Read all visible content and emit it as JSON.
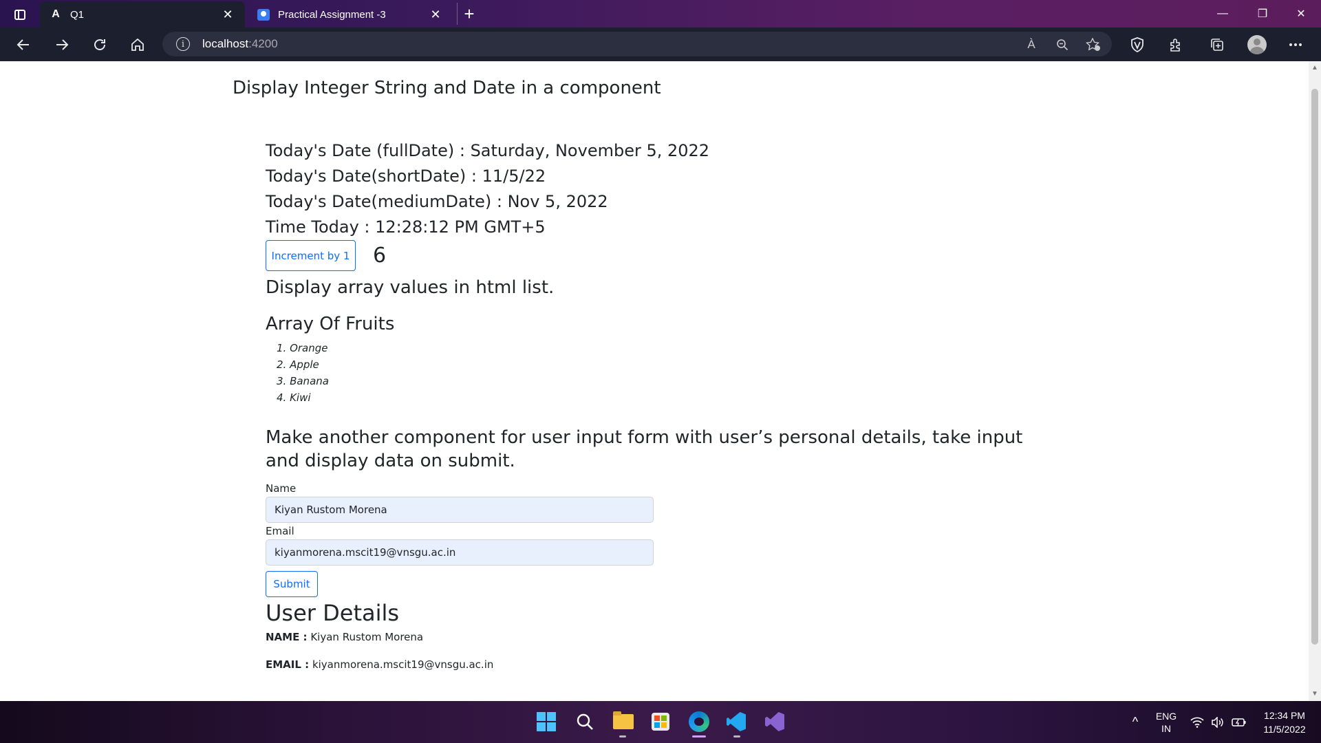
{
  "browser": {
    "tabs": [
      {
        "title": "Q1",
        "favicon": "A",
        "active": true
      },
      {
        "title": "Practical Assignment -3",
        "favicon": "doc-icon",
        "active": false
      }
    ],
    "new_tab_glyph": "+",
    "close_glyph": "✕",
    "window_controls": {
      "minimize": "—",
      "restore": "❐",
      "close": "✕"
    },
    "url_host": "localhost",
    "url_port": ":4200",
    "read_aloud_glyph": "À"
  },
  "page": {
    "main_heading": "Display Integer String and Date in a component",
    "dates": [
      "Today's Date (fullDate) : Saturday, November 5, 2022",
      "Today's Date(shortDate) : 11/5/22",
      "Today's Date(mediumDate) : Nov 5, 2022",
      "Time Today : 12:28:12 PM GMT+5"
    ],
    "increment_label": "Increment by 1",
    "counter_value": "6",
    "array_heading": "Display array values in html list.",
    "fruits_heading": "Array Of Fruits",
    "fruits": [
      "1. Orange",
      "2. Apple",
      "3. Banana",
      "4. Kiwi"
    ],
    "form_heading": "Make another component for user input form with user’s personal details, take input and display data on submit.",
    "name_label": "Name",
    "name_value": "Kiyan Rustom Morena",
    "email_label": "Email",
    "email_value": "kiyanmorena.mscit19@vnsgu.ac.in",
    "submit_label": "Submit",
    "user_details_heading": "User Details",
    "name_detail_label": "NAME :",
    "name_detail_value": "Kiyan Rustom Morena",
    "email_detail_label": "EMAIL :",
    "email_detail_value": "kiyanmorena.mscit19@vnsgu.ac.in"
  },
  "taskbar": {
    "language_line1": "ENG",
    "language_line2": "IN",
    "time": "12:34 PM",
    "date": "11/5/2022",
    "tray_chevron": "^"
  },
  "colors": {
    "primary": "#0d6efd",
    "input_autofill": "#e8f0fe",
    "toolbar": "#1c1f2e"
  }
}
